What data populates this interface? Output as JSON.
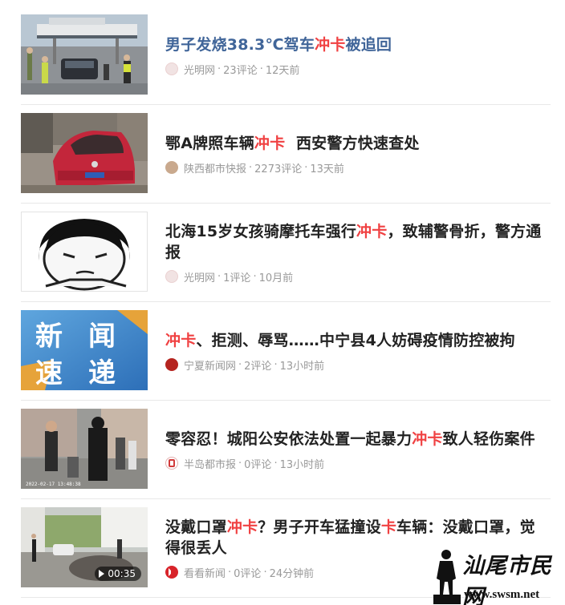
{
  "news": [
    {
      "title_parts": [
        {
          "text": "男子发烧38.3℃驾车",
          "kw": false
        },
        {
          "text": "冲卡",
          "kw": true
        },
        {
          "text": "被追回",
          "kw": false
        }
      ],
      "read": true,
      "source": "光明网",
      "comments": "23评论",
      "time": "12天前",
      "thumb": "toll-gate-checkpoint"
    },
    {
      "title_parts": [
        {
          "text": "鄂A牌照车辆",
          "kw": false
        },
        {
          "text": "冲卡",
          "kw": true
        },
        {
          "text": "  西安警方快速查处",
          "kw": false
        }
      ],
      "read": false,
      "source": "陕西都市快报",
      "comments": "2273评论",
      "time": "13天前",
      "thumb": "red-car"
    },
    {
      "title_parts": [
        {
          "text": "北海15岁女孩骑摩托车强行",
          "kw": false
        },
        {
          "text": "冲卡",
          "kw": true
        },
        {
          "text": "，致辅警骨折，警方通报",
          "kw": false
        }
      ],
      "read": false,
      "source": "光明网",
      "comments": "1评论",
      "time": "10月前",
      "thumb": "cartoon-face"
    },
    {
      "title_parts": [
        {
          "text": "冲卡",
          "kw": true
        },
        {
          "text": "、拒测、辱骂……中宁县4人妨碍疫情防控被拘",
          "kw": false
        }
      ],
      "read": false,
      "source": "宁夏新闻网",
      "comments": "2评论",
      "time": "13小时前",
      "thumb": "news-flash",
      "thumb_text": [
        "新",
        "闻",
        "速",
        "递"
      ]
    },
    {
      "title_parts": [
        {
          "text": "零容忍！城阳公安依法处置一起暴力",
          "kw": false
        },
        {
          "text": "冲卡",
          "kw": true
        },
        {
          "text": "致人轻伤案件",
          "kw": false
        }
      ],
      "read": false,
      "source": "半岛都市报",
      "comments": "0评论",
      "time": "13小时前",
      "thumb": "street-crowd",
      "thumb_stamp": "2022-02-17 13:48:38"
    },
    {
      "title_parts": [
        {
          "text": "没戴口罩",
          "kw": false
        },
        {
          "text": "冲卡",
          "kw": true
        },
        {
          "text": "？男子开车猛撞设",
          "kw": false
        },
        {
          "text": "卡",
          "kw": true
        },
        {
          "text": "车辆：没戴口罩，觉得很丢人",
          "kw": false
        }
      ],
      "read": false,
      "source": "看看新闻",
      "comments": "0评论",
      "time": "24分钟前",
      "thumb": "video-street",
      "duration": "00:35"
    }
  ],
  "colors": {
    "keyword": "#f04142",
    "read_title": "#406599",
    "meta": "#999999"
  },
  "watermark": {
    "text": "汕尾市民网",
    "url": "www.swsm.net"
  }
}
